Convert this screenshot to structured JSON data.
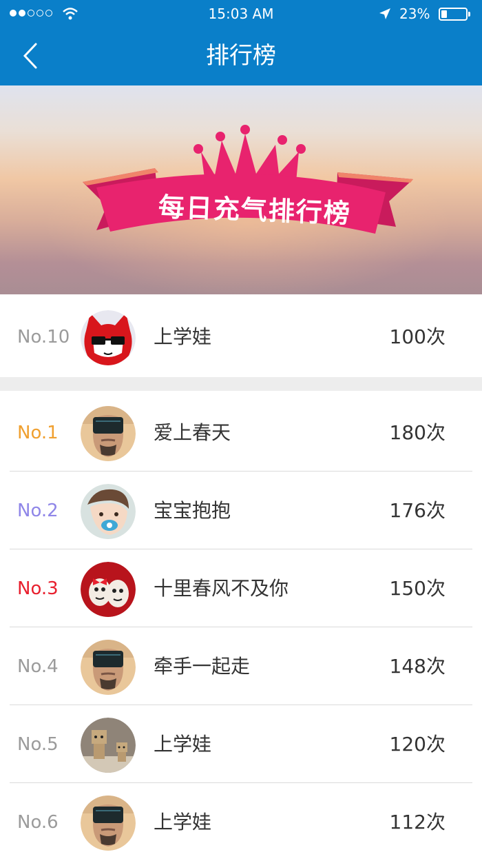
{
  "status_bar": {
    "time": "15:03 AM",
    "battery": "23%"
  },
  "nav": {
    "title": "排行榜"
  },
  "banner": {
    "ribbon_text": "每日充气排行榜"
  },
  "my_rank": {
    "rank": "No.10",
    "name": "上学娃",
    "count": "100次",
    "rank_color": "#9b9b9b",
    "avatar": "fox-sunglasses-avatar"
  },
  "ranking": [
    {
      "rank": "No.1",
      "name": "爱上春天",
      "count": "180次",
      "rank_color": "#f0a030",
      "avatar": "man-sunglasses-avatar"
    },
    {
      "rank": "No.2",
      "name": "宝宝抱抱",
      "count": "176次",
      "rank_color": "#8f86e8",
      "avatar": "baby-avatar"
    },
    {
      "rank": "No.3",
      "name": "十里春风不及你",
      "count": "150次",
      "rank_color": "#e8202e",
      "avatar": "eggs-avatar"
    },
    {
      "rank": "No.4",
      "name": "牵手一起走",
      "count": "148次",
      "rank_color": "#9b9b9b",
      "avatar": "man-sunglasses-avatar"
    },
    {
      "rank": "No.5",
      "name": "上学娃",
      "count": "120次",
      "rank_color": "#9b9b9b",
      "avatar": "box-robots-avatar"
    },
    {
      "rank": "No.6",
      "name": "上学娃",
      "count": "112次",
      "rank_color": "#9b9b9b",
      "avatar": "man-sunglasses-avatar"
    }
  ]
}
